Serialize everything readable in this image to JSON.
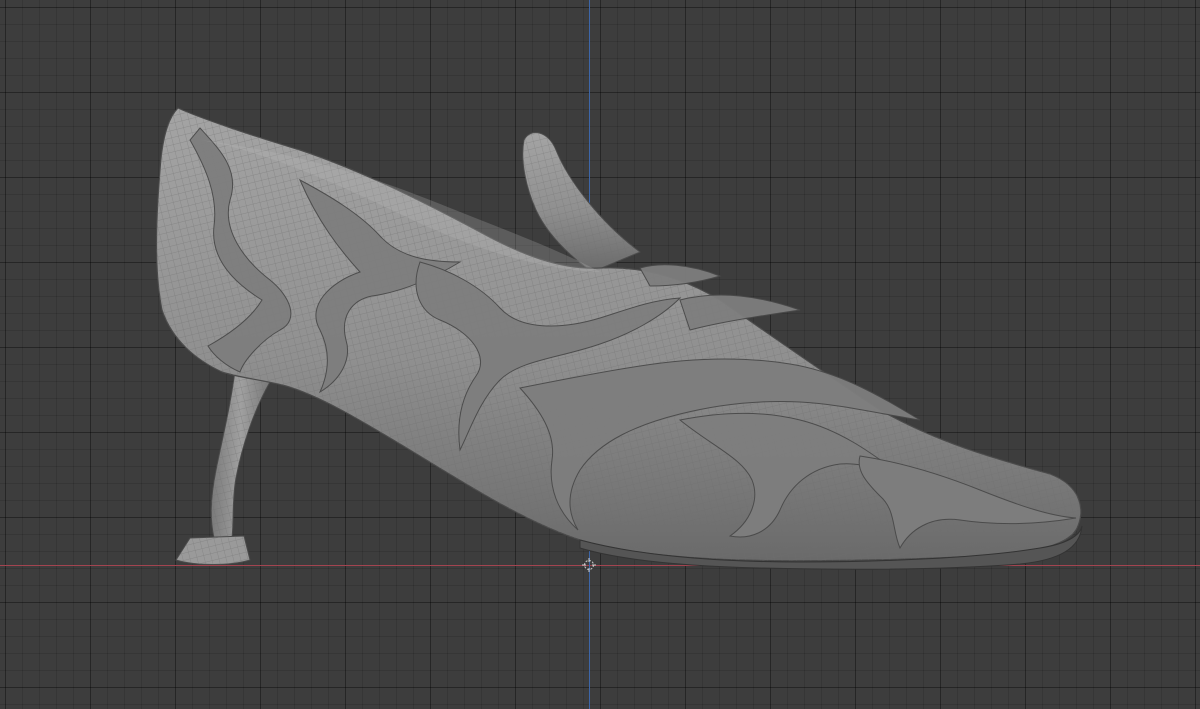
{
  "viewport": {
    "background_color": "#3d3d3d",
    "x_axis_color": "#a34450",
    "y_axis_color": "#3d66a8",
    "mesh_color": "#8e8e8e"
  },
  "icons": {
    "origin": "origin-crosshair-icon"
  }
}
